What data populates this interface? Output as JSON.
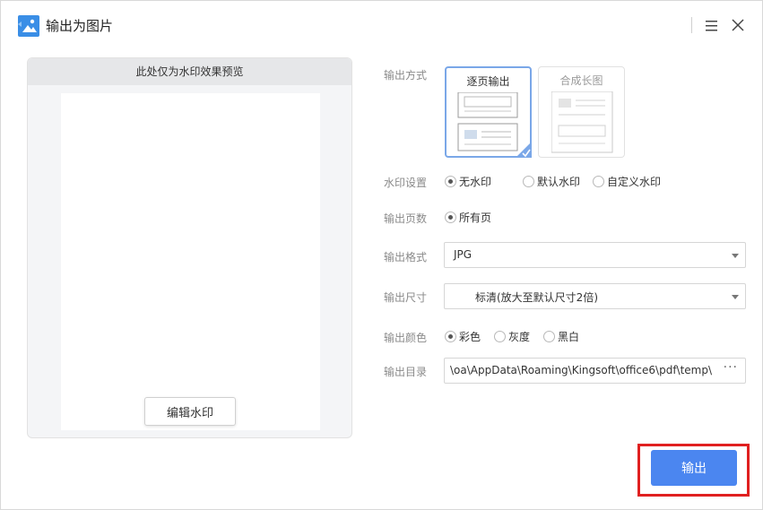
{
  "window": {
    "title": "输出为图片",
    "accent_color": "#4b86f0"
  },
  "preview": {
    "header": "此处仅为水印效果预览",
    "edit_watermark_label": "编辑水印"
  },
  "form": {
    "mode": {
      "label": "输出方式",
      "options": [
        {
          "label": "逐页输出",
          "selected": true
        },
        {
          "label": "合成长图",
          "selected": false
        }
      ]
    },
    "watermark": {
      "label": "水印设置",
      "options": [
        {
          "label": "无水印",
          "selected": true
        },
        {
          "label": "默认水印",
          "selected": false
        },
        {
          "label": "自定义水印",
          "selected": false
        }
      ]
    },
    "pages": {
      "label": "输出页数",
      "options": [
        {
          "label": "所有页",
          "selected": true
        }
      ]
    },
    "format": {
      "label": "输出格式",
      "value": "JPG"
    },
    "size": {
      "label": "输出尺寸",
      "value": "标清(放大至默认尺寸2倍)"
    },
    "color": {
      "label": "输出颜色",
      "options": [
        {
          "label": "彩色",
          "selected": true
        },
        {
          "label": "灰度",
          "selected": false
        },
        {
          "label": "黑白",
          "selected": false
        }
      ]
    },
    "directory": {
      "label": "输出目录",
      "value": "\\oa\\AppData\\Roaming\\Kingsoft\\office6\\pdf\\temp\\",
      "more_label": "···"
    }
  },
  "actions": {
    "export_label": "输出"
  },
  "icons": {
    "app": "image-app-icon",
    "menu": "hamburger-menu-icon",
    "close": "close-icon",
    "more": "ellipsis-icon",
    "selected": "checkmark-icon"
  }
}
